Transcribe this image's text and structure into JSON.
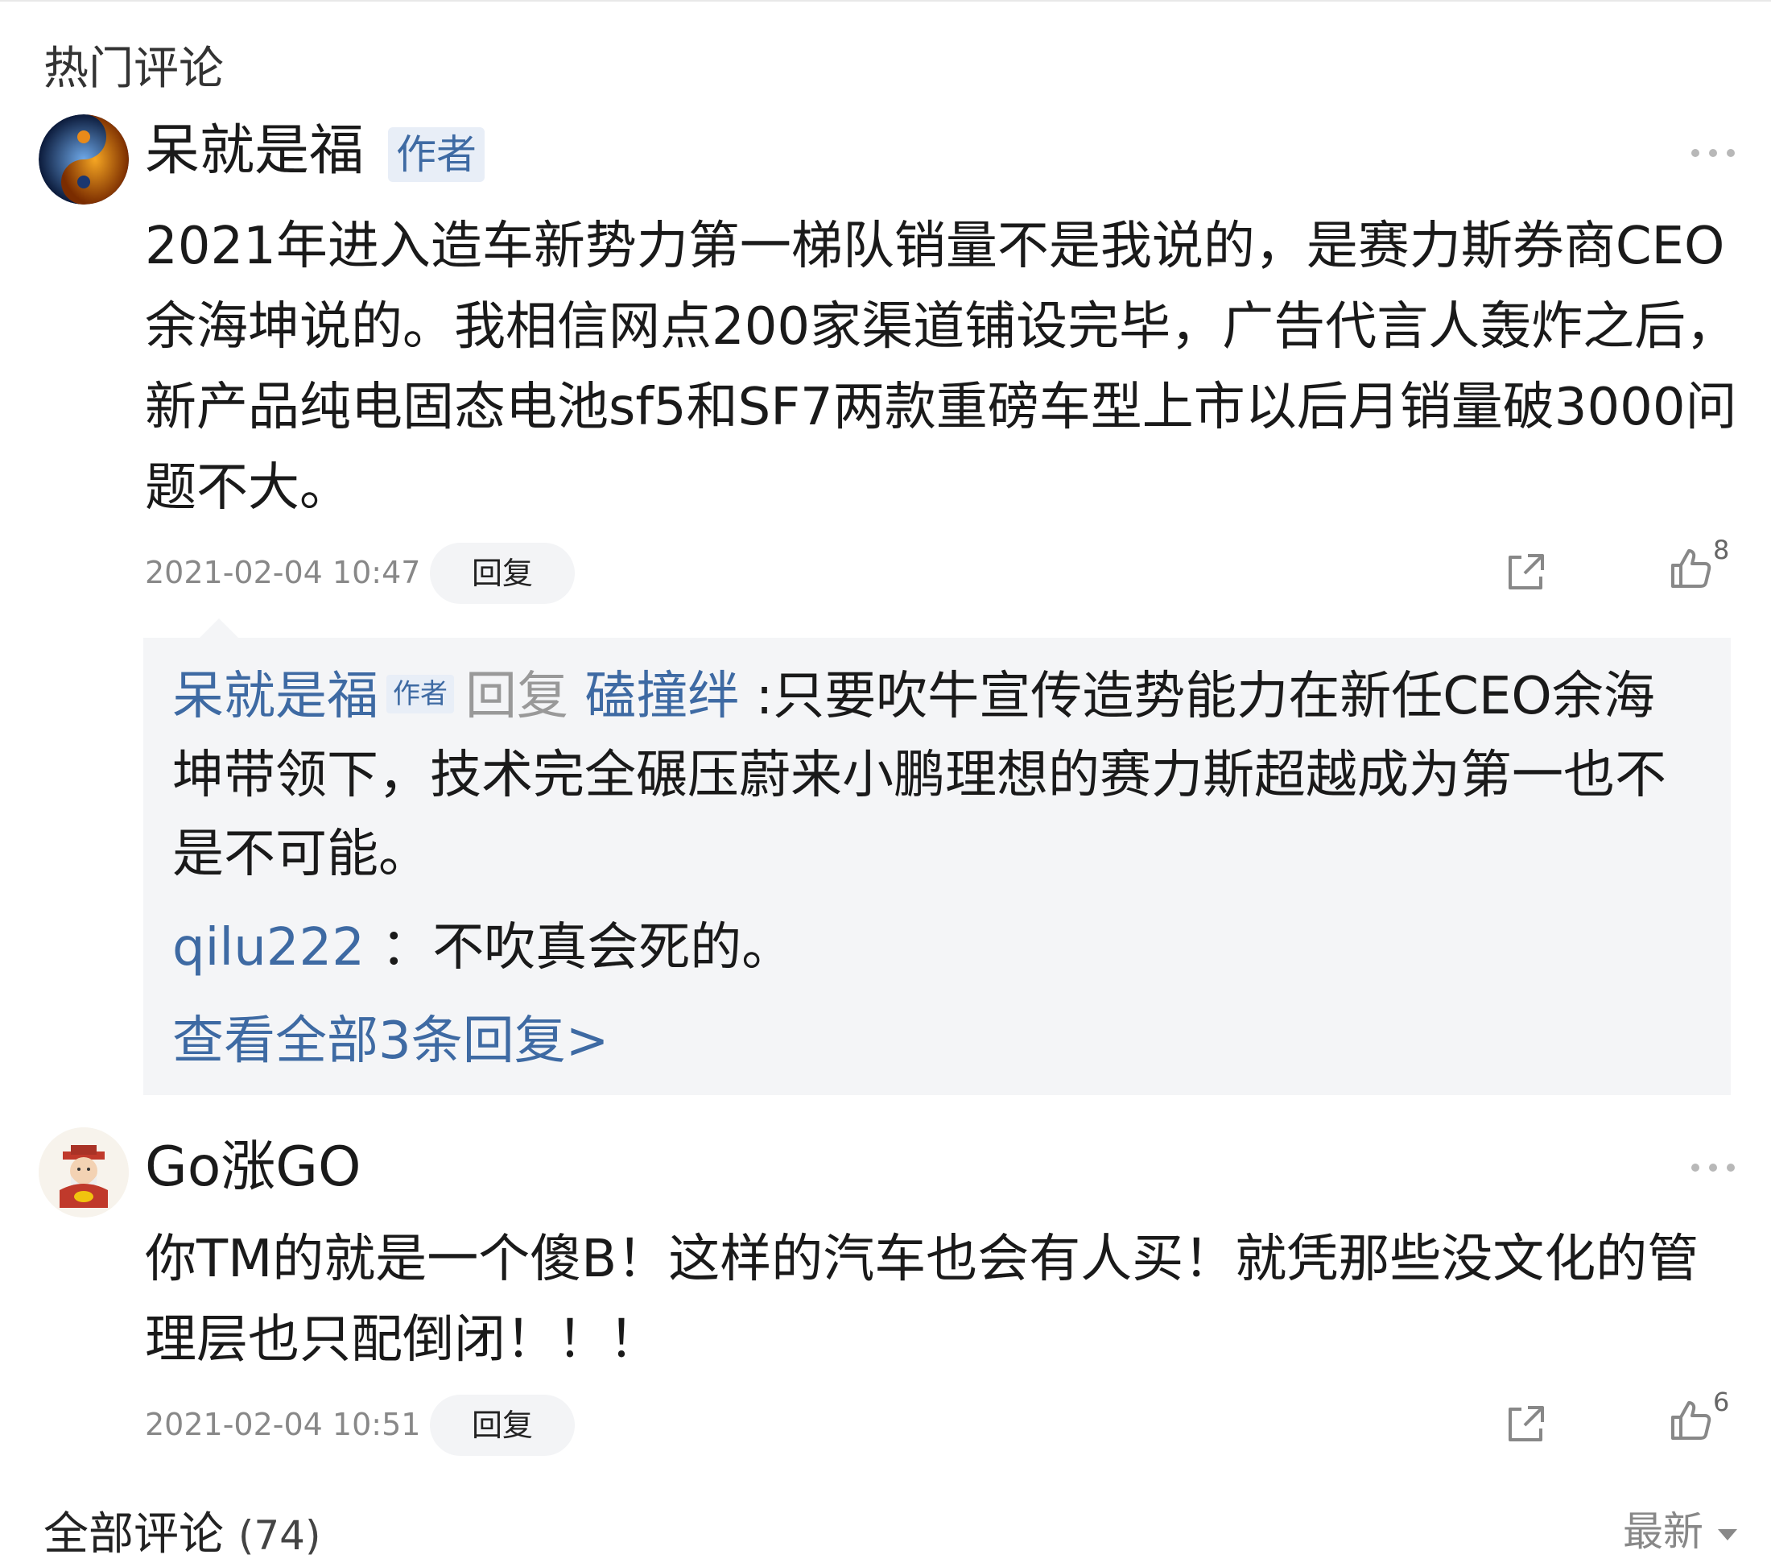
{
  "hot_section": {
    "title": "热门评论"
  },
  "comments": [
    {
      "username": "呆就是福",
      "badge": "作者",
      "text": "2021年进入造车新势力第一梯队销量不是我说的，是赛力斯券商CEO余海坤说的。我相信网点200家渠道铺设完毕，广告代言人轰炸之后，新产品纯电固态电池sf5和SF7两款重磅车型上市以后月销量破3000问题不大。",
      "timestamp": "2021-02-04 10:47",
      "reply_label": "回复",
      "likes": "8",
      "replies": [
        {
          "author": "呆就是福",
          "author_badge": "作者",
          "reply_word": "回复",
          "target": "磕撞绊",
          "separator": ":",
          "text": "只要吹牛宣传造势能力在新任CEO余海坤带领下，技术完全碾压蔚来小鹏理想的赛力斯超越成为第一也不是不可能。"
        },
        {
          "author": "qilu222",
          "separator": "：",
          "text": "不吹真会死的。"
        }
      ],
      "view_all": "查看全部3条回复>"
    },
    {
      "username": "Go涨GO",
      "text": "你TM的就是一个傻B！这样的汽车也会有人买！就凭那些没文化的管理层也只配倒闭！！！",
      "timestamp": "2021-02-04 10:51",
      "reply_label": "回复",
      "likes": "6"
    }
  ],
  "all_section": {
    "title": "全部评论",
    "count": "(74)",
    "sort_label": "最新"
  }
}
